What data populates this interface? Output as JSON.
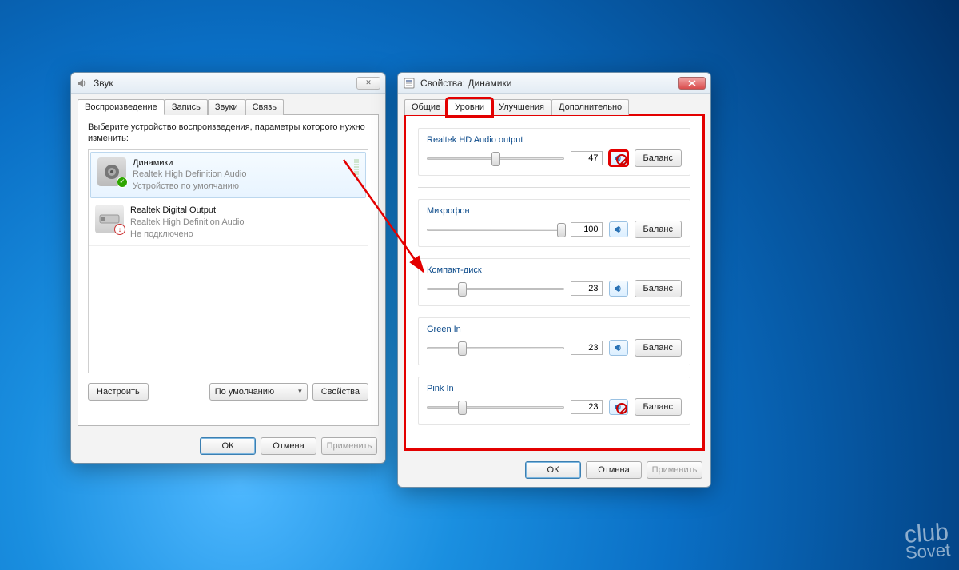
{
  "sound_window": {
    "title": "Звук",
    "tabs": [
      "Воспроизведение",
      "Запись",
      "Звуки",
      "Связь"
    ],
    "active_tab": 0,
    "instruction": "Выберите устройство воспроизведения, параметры которого нужно изменить:",
    "devices": [
      {
        "name": "Динамики",
        "driver": "Realtek High Definition Audio",
        "status": "Устройство по умолчанию",
        "default": true
      },
      {
        "name": "Realtek Digital Output",
        "driver": "Realtek High Definition Audio",
        "status": "Не подключено",
        "default": false
      }
    ],
    "configure_btn": "Настроить",
    "default_dropdown": "По умолчанию",
    "properties_btn": "Свойства",
    "ok": "ОК",
    "cancel": "Отмена",
    "apply": "Применить"
  },
  "props_window": {
    "title": "Свойства: Динамики",
    "tabs": [
      "Общие",
      "Уровни",
      "Улучшения",
      "Дополнительно"
    ],
    "active_tab": 1,
    "levels": [
      {
        "label": "Realtek HD Audio output",
        "value": 47,
        "muted": true,
        "highlighted": true
      },
      {
        "label": "Микрофон",
        "value": 100,
        "muted": false
      },
      {
        "label": "Компакт-диск",
        "value": 23,
        "muted": false
      },
      {
        "label": "Green In",
        "value": 23,
        "muted": false
      },
      {
        "label": "Pink In",
        "value": 23,
        "muted": true
      }
    ],
    "balance_btn": "Баланс",
    "ok": "ОК",
    "cancel": "Отмена",
    "apply": "Применить"
  },
  "watermark": {
    "line1": "club",
    "line2": "Sovet"
  }
}
